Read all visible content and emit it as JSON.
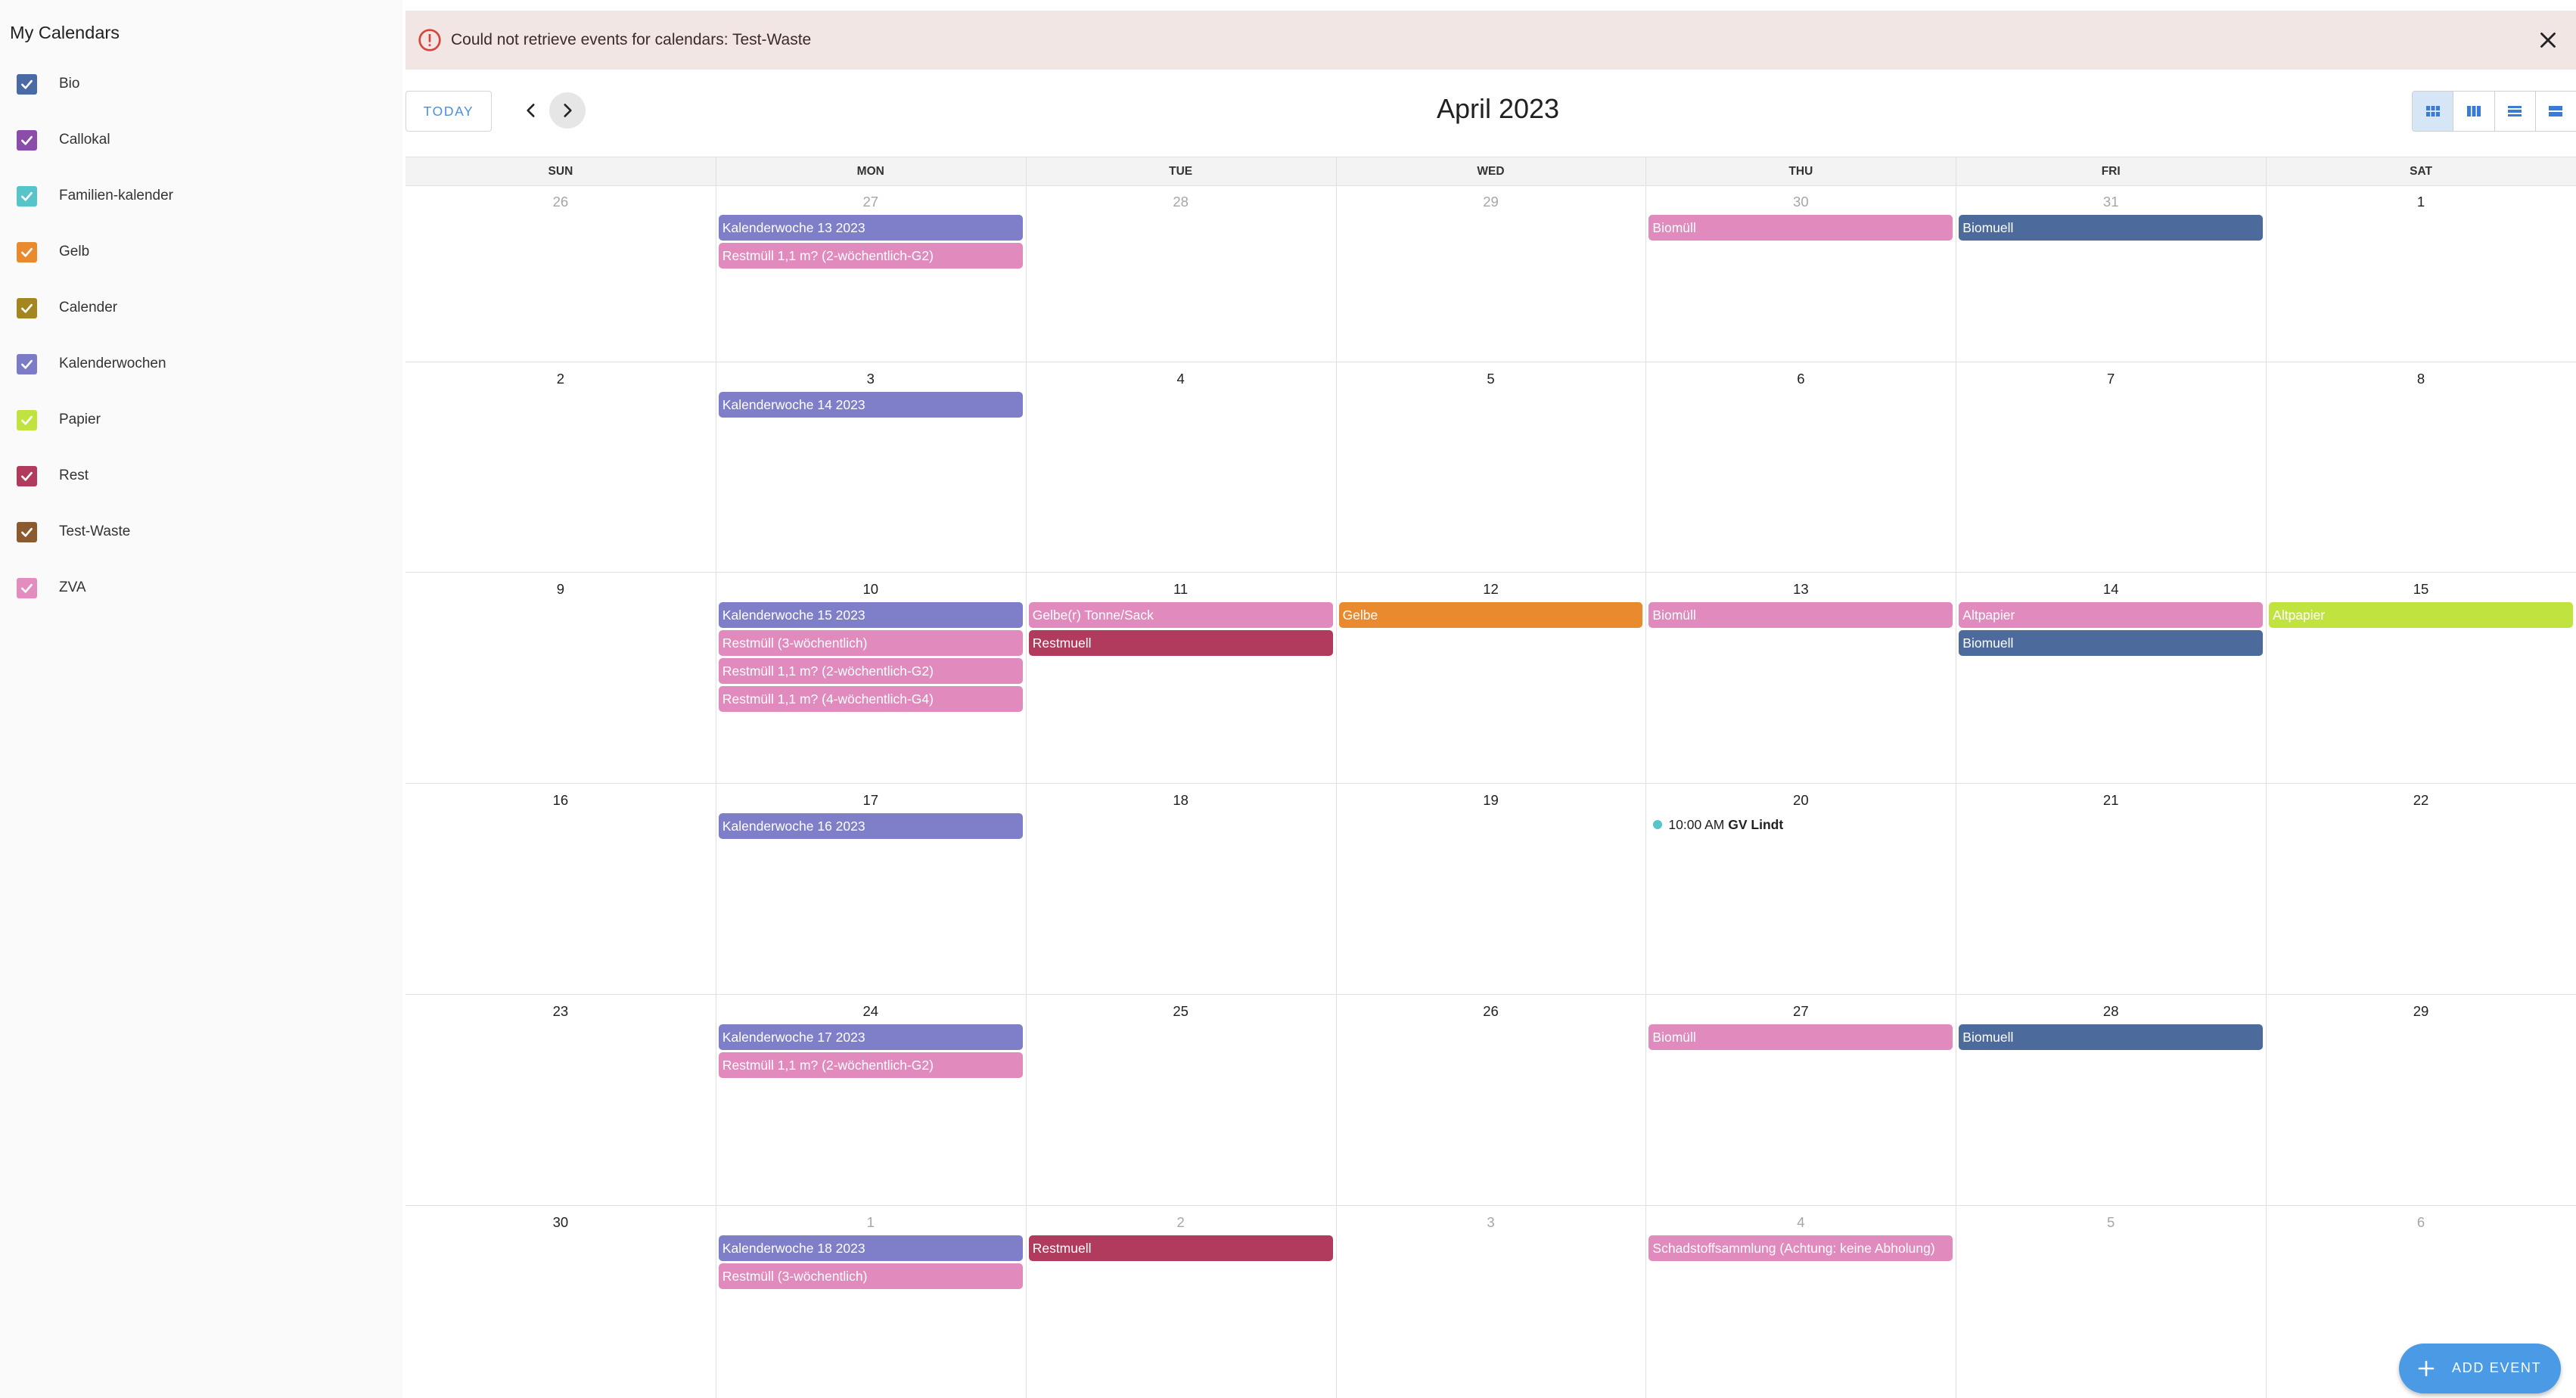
{
  "sidebar": {
    "title": "My Calendars",
    "calendars": [
      {
        "label": "Bio",
        "color": "#4a6aa5"
      },
      {
        "label": "Callokal",
        "color": "#8a4eaa"
      },
      {
        "label": "Familien-kalender",
        "color": "#56c4c9"
      },
      {
        "label": "Gelb",
        "color": "#ea8a2f"
      },
      {
        "label": "Calender",
        "color": "#a3861f"
      },
      {
        "label": "Kalenderwochen",
        "color": "#7c7bc6"
      },
      {
        "label": "Papier",
        "color": "#c1e33f"
      },
      {
        "label": "Rest",
        "color": "#b03b5c"
      },
      {
        "label": "Test-Waste",
        "color": "#8c5a2f"
      },
      {
        "label": "ZVA",
        "color": "#e28cbf"
      }
    ]
  },
  "alert": {
    "message": "Could not retrieve events for calendars: Test-Waste"
  },
  "toolbar": {
    "today_label": "TODAY",
    "month_title": "April 2023",
    "views": [
      "month-view-icon",
      "week-view-icon",
      "day-view-icon",
      "list-view-icon"
    ],
    "active_view": "month-view-icon"
  },
  "colors": {
    "kalenderwoche": "#7f7fc9",
    "restmuell_zva": "#e08abd",
    "biomuell": "#4c6a9b",
    "restmuell": "#b03b5c",
    "gelbe": "#ea8a2f",
    "altpapier": "#c1e33f",
    "timed_dot": "#56c4c9",
    "accent": "#4b9ae6"
  },
  "weekdays": [
    "SUN",
    "MON",
    "TUE",
    "WED",
    "THU",
    "FRI",
    "SAT"
  ],
  "weeks": [
    {
      "days": [
        {
          "num": "26",
          "other": true,
          "events": []
        },
        {
          "num": "27",
          "other": true,
          "events": [
            {
              "title": "Kalenderwoche 13 2023",
              "color": "#7f7fc9"
            },
            {
              "title": "Restmüll 1,1 m? (2-wöchentlich-G2)",
              "color": "#e08abd"
            }
          ]
        },
        {
          "num": "28",
          "other": true,
          "events": []
        },
        {
          "num": "29",
          "other": true,
          "events": []
        },
        {
          "num": "30",
          "other": true,
          "events": [
            {
              "title": "Biomüll",
              "color": "#e08abd"
            }
          ]
        },
        {
          "num": "31",
          "other": true,
          "events": [
            {
              "title": "Biomuell",
              "color": "#4c6a9b"
            }
          ]
        },
        {
          "num": "1",
          "other": false,
          "events": []
        }
      ]
    },
    {
      "days": [
        {
          "num": "2",
          "other": false,
          "events": []
        },
        {
          "num": "3",
          "other": false,
          "events": [
            {
              "title": "Kalenderwoche 14 2023",
              "color": "#7f7fc9"
            }
          ]
        },
        {
          "num": "4",
          "other": false,
          "events": []
        },
        {
          "num": "5",
          "other": false,
          "events": []
        },
        {
          "num": "6",
          "other": false,
          "events": []
        },
        {
          "num": "7",
          "other": false,
          "events": []
        },
        {
          "num": "8",
          "other": false,
          "events": []
        }
      ]
    },
    {
      "days": [
        {
          "num": "9",
          "other": false,
          "events": []
        },
        {
          "num": "10",
          "other": false,
          "events": [
            {
              "title": "Kalenderwoche 15 2023",
              "color": "#7f7fc9"
            },
            {
              "title": "Restmüll (3-wöchentlich)",
              "color": "#e08abd"
            },
            {
              "title": "Restmüll 1,1 m? (2-wöchentlich-G2)",
              "color": "#e08abd"
            },
            {
              "title": "Restmüll 1,1 m? (4-wöchentlich-G4)",
              "color": "#e08abd"
            }
          ]
        },
        {
          "num": "11",
          "other": false,
          "events": [
            {
              "title": "Gelbe(r) Tonne/Sack",
              "color": "#e08abd"
            },
            {
              "title": "Restmuell",
              "color": "#b03b5c"
            }
          ]
        },
        {
          "num": "12",
          "other": false,
          "events": [
            {
              "title": "Gelbe",
              "color": "#ea8a2f"
            }
          ]
        },
        {
          "num": "13",
          "other": false,
          "events": [
            {
              "title": "Biomüll",
              "color": "#e08abd"
            }
          ]
        },
        {
          "num": "14",
          "other": false,
          "events": [
            {
              "title": "Altpapier",
              "color": "#e08abd"
            },
            {
              "title": "Biomuell",
              "color": "#4c6a9b"
            }
          ]
        },
        {
          "num": "15",
          "other": false,
          "events": [
            {
              "title": "Altpapier",
              "color": "#c1e33f"
            }
          ]
        }
      ]
    },
    {
      "days": [
        {
          "num": "16",
          "other": false,
          "events": []
        },
        {
          "num": "17",
          "other": false,
          "events": [
            {
              "title": "Kalenderwoche 16 2023",
              "color": "#7f7fc9"
            }
          ]
        },
        {
          "num": "18",
          "other": false,
          "events": []
        },
        {
          "num": "19",
          "other": false,
          "events": []
        },
        {
          "num": "20",
          "other": false,
          "events": [],
          "timed": [
            {
              "time": "10:00 AM",
              "title": "GV Lindt",
              "color": "#56c4c9"
            }
          ]
        },
        {
          "num": "21",
          "other": false,
          "events": []
        },
        {
          "num": "22",
          "other": false,
          "events": []
        }
      ]
    },
    {
      "days": [
        {
          "num": "23",
          "other": false,
          "events": []
        },
        {
          "num": "24",
          "other": false,
          "events": [
            {
              "title": "Kalenderwoche 17 2023",
              "color": "#7f7fc9"
            },
            {
              "title": "Restmüll 1,1 m? (2-wöchentlich-G2)",
              "color": "#e08abd"
            }
          ]
        },
        {
          "num": "25",
          "other": false,
          "events": []
        },
        {
          "num": "26",
          "other": false,
          "events": []
        },
        {
          "num": "27",
          "other": false,
          "events": [
            {
              "title": "Biomüll",
              "color": "#e08abd"
            }
          ]
        },
        {
          "num": "28",
          "other": false,
          "events": [
            {
              "title": "Biomuell",
              "color": "#4c6a9b"
            }
          ]
        },
        {
          "num": "29",
          "other": false,
          "events": []
        }
      ]
    },
    {
      "days": [
        {
          "num": "30",
          "other": false,
          "events": []
        },
        {
          "num": "1",
          "other": true,
          "events": [
            {
              "title": "Kalenderwoche 18 2023",
              "color": "#7f7fc9"
            },
            {
              "title": "Restmüll (3-wöchentlich)",
              "color": "#e08abd"
            }
          ]
        },
        {
          "num": "2",
          "other": true,
          "events": [
            {
              "title": "Restmuell",
              "color": "#b03b5c"
            }
          ]
        },
        {
          "num": "3",
          "other": true,
          "events": []
        },
        {
          "num": "4",
          "other": true,
          "events": [
            {
              "title": "Schadstoffsammlung (Achtung: keine Abholung)",
              "color": "#e08abd"
            }
          ]
        },
        {
          "num": "5",
          "other": true,
          "events": []
        },
        {
          "num": "6",
          "other": true,
          "events": []
        }
      ]
    }
  ],
  "fab": {
    "label": "ADD EVENT"
  }
}
